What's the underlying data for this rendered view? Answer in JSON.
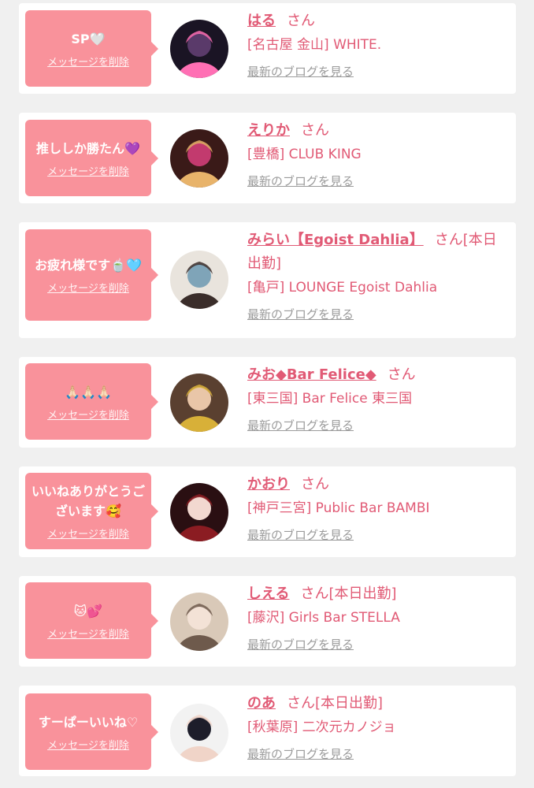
{
  "colors": {
    "background": "#f0f0f0",
    "bubble": "#f9929b",
    "accent": "#e15a75",
    "muted": "#9b9b9b"
  },
  "messages": [
    {
      "bubble_text": "SP🤍",
      "delete_label": "メッセージを削除",
      "name": "はる",
      "honorific": "さん",
      "extra": "",
      "shop": "[名古屋 金山] WHITE.",
      "blog_link": "最新のブログを見る",
      "avatar_colors": [
        "#1a1424",
        "#5a3a6a",
        "#ff6fb4"
      ]
    },
    {
      "bubble_text": "推ししか勝たん💜",
      "delete_label": "メッセージを削除",
      "name": "えりか",
      "honorific": "さん",
      "extra": "",
      "shop": "[豊橋] CLUB KING",
      "blog_link": "最新のブログを見る",
      "avatar_colors": [
        "#3a1a18",
        "#c23a6e",
        "#e8b36a"
      ]
    },
    {
      "bubble_text": "お疲れ様です🍵🩵",
      "delete_label": "メッセージを削除",
      "name": "みらい【Egoist Dahlia】",
      "honorific": "さん",
      "extra": "[本日出勤]",
      "shop": "[亀戸] LOUNGE Egoist Dahlia",
      "blog_link": "最新のブログを見る",
      "avatar_colors": [
        "#e9e4dd",
        "#7fa4b8",
        "#3a2d2a"
      ]
    },
    {
      "bubble_text": "🙏🏻🙏🏻🙏🏻",
      "delete_label": "メッセージを削除",
      "name": "みお◆Bar Felice◆",
      "honorific": "さん",
      "extra": "",
      "shop": "[東三国] Bar Felice 東三国",
      "blog_link": "最新のブログを見る",
      "avatar_colors": [
        "#5a4030",
        "#e9c6a8",
        "#d8b038"
      ]
    },
    {
      "bubble_text": "いいねありがとうございます🥰",
      "delete_label": "メッセージを削除",
      "name": "かおり",
      "honorific": "さん",
      "extra": "",
      "shop": "[神戸三宮] Public Bar BAMBI",
      "blog_link": "最新のブログを見る",
      "avatar_colors": [
        "#2a0f12",
        "#f2d8d0",
        "#8b1c22"
      ]
    },
    {
      "bubble_text": "🐱💕",
      "delete_label": "メッセージを削除",
      "name": "しえる",
      "honorific": "さん",
      "extra": "[本日出勤]",
      "shop": "[藤沢] Girls Bar STELLA",
      "blog_link": "最新のブログを見る",
      "avatar_colors": [
        "#d9c9b8",
        "#f3e2d6",
        "#6e5a4c"
      ]
    },
    {
      "bubble_text": "すーぱーいいね♡",
      "delete_label": "メッセージを削除",
      "name": "のあ",
      "honorific": "さん",
      "extra": "[本日出勤]",
      "shop": "[秋葉原] 二次元カノジョ",
      "blog_link": "最新のブログを見る",
      "avatar_colors": [
        "#f2f2f2",
        "#1d1d2a",
        "#f0d4c8"
      ]
    }
  ]
}
